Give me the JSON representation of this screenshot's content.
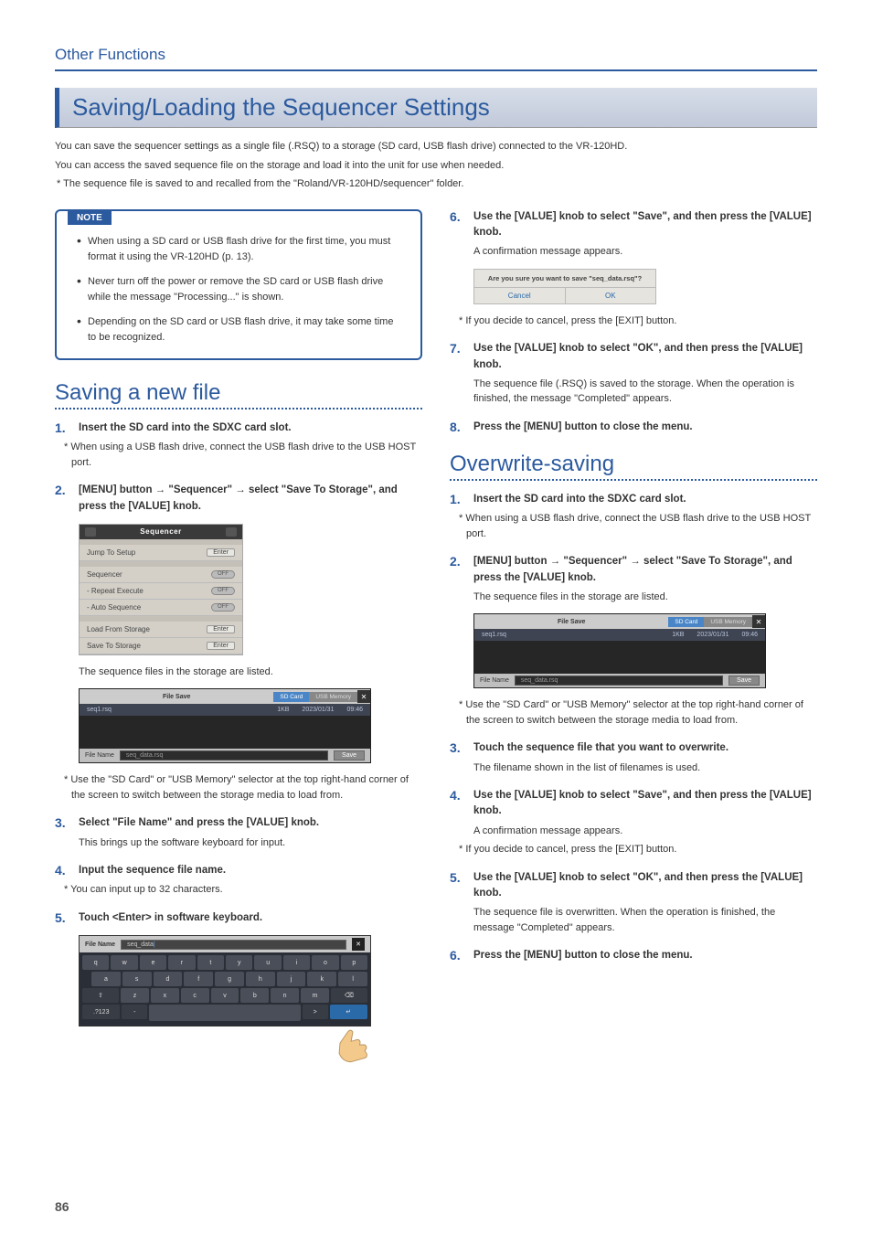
{
  "breadcrumb": "Other Functions",
  "page_number": "86",
  "title": "Saving/Loading the Sequencer Settings",
  "intro": {
    "line1": "You can save the sequencer settings as a single file (.RSQ) to a storage (SD card, USB flash drive) connected to the VR-120HD.",
    "line2": "You can access the saved sequence file on the storage and load it into the unit for use when needed.",
    "line3": "*  The sequence file is saved to and recalled from the \"Roland/VR-120HD/sequencer\" folder."
  },
  "note": {
    "label": "NOTE",
    "items": [
      "When using a SD card or USB flash drive for the first time, you must format it using the VR-120HD (p. 13).",
      "Never turn off the power or remove the SD card or USB flash drive while the message \"Processing...\" is shown.",
      "Depending on the SD card or USB flash drive, it may take some time to be recognized."
    ]
  },
  "saving_new": {
    "heading": "Saving a new file",
    "steps": {
      "s1": {
        "num": "1.",
        "bold": "Insert the SD card into the SDXC card slot.",
        "note": "*  When using a USB flash drive, connect the USB flash drive to the USB HOST port."
      },
      "s2": {
        "num": "2.",
        "bold_a": "[MENU] button ",
        "bold_b": " \"Sequencer\" ",
        "bold_c": " select \"Save To Storage\", and press the [VALUE] knob."
      },
      "s2_caption": "The sequence files in the storage are listed.",
      "s2_note": "*  Use the \"SD Card\" or \"USB Memory\" selector at the top right-hand corner of the screen to switch between the storage media to load from.",
      "s3": {
        "num": "3.",
        "bold": "Select \"File Name\" and press the [VALUE] knob.",
        "body": "This brings up the software keyboard for input."
      },
      "s4": {
        "num": "4.",
        "bold": "Input the sequence file name.",
        "note": "*  You can input up to 32 characters."
      },
      "s5": {
        "num": "5.",
        "bold": "Touch <Enter> in software keyboard."
      },
      "s6": {
        "num": "6.",
        "bold": "Use the [VALUE] knob to select \"Save\", and then press the [VALUE] knob.",
        "body": "A confirmation message appears.",
        "note": "*  If you decide to cancel, press the [EXIT] button."
      },
      "s7": {
        "num": "7.",
        "bold": "Use the [VALUE] knob to select \"OK\", and then press the [VALUE] knob.",
        "body": "The sequence file (.RSQ) is saved to the storage. When the operation is finished, the message \"Completed\" appears."
      },
      "s8": {
        "num": "8.",
        "bold": "Press the [MENU] button to close the menu."
      }
    },
    "seq_panel": {
      "title": "Sequencer",
      "rows": {
        "jump": "Jump To Setup",
        "enter": "Enter",
        "seq": "Sequencer",
        "off": "OFF",
        "repeat": "- Repeat Execute",
        "auto": "- Auto Sequence",
        "load": "Load From Storage",
        "save": "Save To Storage"
      }
    },
    "file_panel": {
      "title": "File Save",
      "tab1": "SD Card",
      "tab2": "USB Memory",
      "row_name": "seq1.rsq",
      "row_size": "1KB",
      "row_date": "2023/01/31",
      "row_time": "09:46",
      "file_label": "File Name",
      "file_input": "seq_data.rsq",
      "save_btn": "Save"
    },
    "kb_panel": {
      "label": "File Name",
      "value": "seq_data"
    }
  },
  "overwrite": {
    "heading": "Overwrite-saving",
    "steps": {
      "s1": {
        "num": "1.",
        "bold": "Insert the SD card into the SDXC card slot.",
        "note": "*  When using a USB flash drive, connect the USB flash drive to the USB HOST port."
      },
      "s2": {
        "num": "2.",
        "bold_a": "[MENU] button ",
        "bold_b": " \"Sequencer\" ",
        "bold_c": " select \"Save To Storage\", and press the [VALUE] knob.",
        "body": "The sequence files in the storage are listed.",
        "note": "*  Use the \"SD Card\" or \"USB Memory\" selector at the top right-hand corner of the screen to switch between the storage media to load from."
      },
      "s3": {
        "num": "3.",
        "bold": "Touch the sequence file that you want to overwrite.",
        "body": "The filename shown in the list of filenames is used."
      },
      "s4": {
        "num": "4.",
        "bold": "Use the [VALUE] knob to select \"Save\", and then press the [VALUE] knob.",
        "body": "A confirmation message appears.",
        "note": "*  If you decide to cancel, press the [EXIT] button."
      },
      "s5": {
        "num": "5.",
        "bold": "Use the [VALUE] knob to select \"OK\", and then press the [VALUE] knob.",
        "body": "The sequence file is overwritten. When the operation is finished, the message \"Completed\" appears."
      },
      "s6": {
        "num": "6.",
        "bold": "Press the [MENU] button to close the menu."
      }
    },
    "confirm": {
      "msg": "Are you sure you want to save \"seq_data.rsq\"?",
      "cancel": "Cancel",
      "ok": "OK"
    }
  }
}
